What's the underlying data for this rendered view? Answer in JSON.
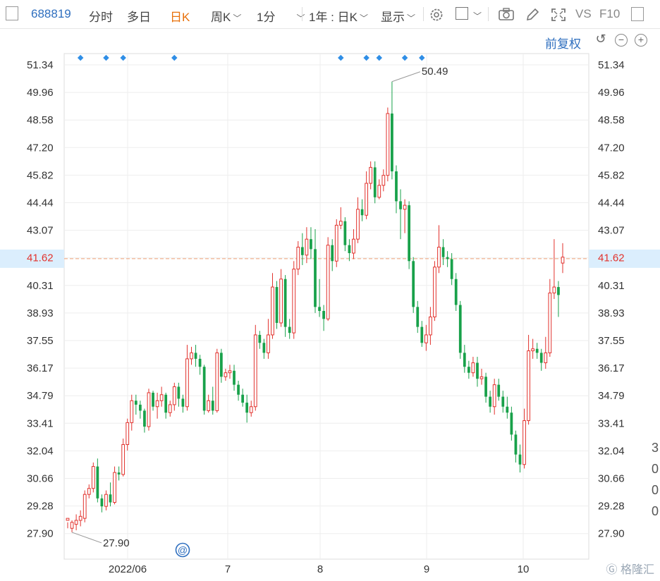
{
  "toolbar": {
    "code": "688819",
    "fenshi": "分时",
    "duori": "多日",
    "rik": "日K",
    "zhouk": "周K",
    "oneminute": "1分",
    "range": "1年 : 日K",
    "display": "显示",
    "vs": "VS",
    "f10": "F10"
  },
  "subbar": {
    "adjust": "前复权"
  },
  "colors": {
    "up": "#e2322d",
    "down": "#18a14a",
    "accent": "#2f6fbf",
    "current_line": "#f0a37a"
  },
  "chart_data": {
    "type": "candlestick",
    "y_ticks": [
      "51.34",
      "49.96",
      "48.58",
      "47.20",
      "45.82",
      "44.44",
      "43.07",
      "41.62",
      "40.31",
      "38.93",
      "37.55",
      "36.17",
      "34.79",
      "33.41",
      "32.04",
      "30.66",
      "29.28",
      "27.90"
    ],
    "x_ticks": [
      "2022/06",
      "7",
      "8",
      "9",
      "10"
    ],
    "current_price": "41.62",
    "high_annotation": "50.49",
    "low_annotation": "27.90",
    "ylim": [
      27.2,
      52.0
    ],
    "candles": [
      [
        28.5,
        28.6,
        28.4,
        28.1
      ],
      [
        28.1,
        28.4,
        28.5,
        27.9
      ],
      [
        28.3,
        28.5,
        28.8,
        28.0
      ],
      [
        28.5,
        28.7,
        29.0,
        28.2
      ],
      [
        28.6,
        29.8,
        30.0,
        28.4
      ],
      [
        29.8,
        30.1,
        30.3,
        29.6
      ],
      [
        30.1,
        31.2,
        31.4,
        29.9
      ],
      [
        31.2,
        29.6,
        31.6,
        29.4
      ],
      [
        29.6,
        29.2,
        29.8,
        28.9
      ],
      [
        29.2,
        29.8,
        30.0,
        29.0
      ],
      [
        29.8,
        29.4,
        30.4,
        29.2
      ],
      [
        29.4,
        30.9,
        31.2,
        29.3
      ],
      [
        30.9,
        30.8,
        31.2,
        30.5
      ],
      [
        30.8,
        32.3,
        32.6,
        30.7
      ],
      [
        32.3,
        33.4,
        33.6,
        32.0
      ],
      [
        33.4,
        34.5,
        34.8,
        33.0
      ],
      [
        34.5,
        34.3,
        34.8,
        33.8
      ],
      [
        34.3,
        34.0,
        34.5,
        33.6
      ],
      [
        34.0,
        33.2,
        34.1,
        32.9
      ],
      [
        33.2,
        34.9,
        35.1,
        33.0
      ],
      [
        34.9,
        34.2,
        35.0,
        34.0
      ],
      [
        34.2,
        34.5,
        34.9,
        33.6
      ],
      [
        34.5,
        34.8,
        35.2,
        34.2
      ],
      [
        34.8,
        33.9,
        34.9,
        33.6
      ],
      [
        33.9,
        34.3,
        34.5,
        33.7
      ],
      [
        34.3,
        35.2,
        35.4,
        34.0
      ],
      [
        35.2,
        34.6,
        35.4,
        34.2
      ],
      [
        34.6,
        34.2,
        34.8,
        33.9
      ],
      [
        34.2,
        36.6,
        37.3,
        34.0
      ],
      [
        36.6,
        36.9,
        37.2,
        36.3
      ],
      [
        36.9,
        36.6,
        37.3,
        36.2
      ],
      [
        36.6,
        36.2,
        36.8,
        35.8
      ],
      [
        36.2,
        34.0,
        36.3,
        33.8
      ],
      [
        34.0,
        34.5,
        34.8,
        33.9
      ],
      [
        34.5,
        34.0,
        35.2,
        33.8
      ],
      [
        34.0,
        36.9,
        37.1,
        33.9
      ],
      [
        36.9,
        35.7,
        37.1,
        35.4
      ],
      [
        35.7,
        35.9,
        36.1,
        35.5
      ],
      [
        35.9,
        36.0,
        36.3,
        35.6
      ],
      [
        36.0,
        35.3,
        36.3,
        35.0
      ],
      [
        35.3,
        34.8,
        35.5,
        34.5
      ],
      [
        34.8,
        34.4,
        35.1,
        34.2
      ],
      [
        34.4,
        33.9,
        34.8,
        33.4
      ],
      [
        33.9,
        34.2,
        34.5,
        33.7
      ],
      [
        34.2,
        37.8,
        38.3,
        34.0
      ],
      [
        37.8,
        37.4,
        38.0,
        37.1
      ],
      [
        37.4,
        36.9,
        37.6,
        36.6
      ],
      [
        36.9,
        37.8,
        38.6,
        36.6
      ],
      [
        37.8,
        40.2,
        40.9,
        37.6
      ],
      [
        40.2,
        38.4,
        40.5,
        38.1
      ],
      [
        38.4,
        40.6,
        41.1,
        38.2
      ],
      [
        40.6,
        38.2,
        40.8,
        37.7
      ],
      [
        38.2,
        37.9,
        38.6,
        37.6
      ],
      [
        37.9,
        41.1,
        41.5,
        37.6
      ],
      [
        41.1,
        42.2,
        42.5,
        40.8
      ],
      [
        42.2,
        41.8,
        42.9,
        41.3
      ],
      [
        41.8,
        42.6,
        43.2,
        41.4
      ],
      [
        42.6,
        42.1,
        43.2,
        41.6
      ],
      [
        42.1,
        39.2,
        43.1,
        38.9
      ],
      [
        39.2,
        39.0,
        40.6,
        38.7
      ],
      [
        39.0,
        38.6,
        39.3,
        38.0
      ],
      [
        38.6,
        42.3,
        42.7,
        38.5
      ],
      [
        42.3,
        41.5,
        42.6,
        41.0
      ],
      [
        41.5,
        43.3,
        43.6,
        41.2
      ],
      [
        43.3,
        43.5,
        44.2,
        43.1
      ],
      [
        43.5,
        42.3,
        43.7,
        42.0
      ],
      [
        42.3,
        41.9,
        42.6,
        41.5
      ],
      [
        41.9,
        42.6,
        43.1,
        41.6
      ],
      [
        42.6,
        44.1,
        44.7,
        42.4
      ],
      [
        44.1,
        43.8,
        44.6,
        43.5
      ],
      [
        43.8,
        45.4,
        46.0,
        43.6
      ],
      [
        45.4,
        46.2,
        46.5,
        45.1
      ],
      [
        46.2,
        44.7,
        46.5,
        44.4
      ],
      [
        44.7,
        45.3,
        45.6,
        44.6
      ],
      [
        45.3,
        45.8,
        46.1,
        45.0
      ],
      [
        45.8,
        48.9,
        49.2,
        45.5
      ],
      [
        48.9,
        46.0,
        50.5,
        45.6
      ],
      [
        46.0,
        44.5,
        46.3,
        43.9
      ],
      [
        44.5,
        44.1,
        45.1,
        42.6
      ],
      [
        44.1,
        44.3,
        44.6,
        42.9
      ],
      [
        44.3,
        41.5,
        44.5,
        41.1
      ],
      [
        41.5,
        39.2,
        41.7,
        38.9
      ],
      [
        39.2,
        38.2,
        39.5,
        37.9
      ],
      [
        38.2,
        37.4,
        38.5,
        37.2
      ],
      [
        37.4,
        37.8,
        38.3,
        37.0
      ],
      [
        37.8,
        38.7,
        39.2,
        37.3
      ],
      [
        38.7,
        41.2,
        41.5,
        38.5
      ],
      [
        41.2,
        42.2,
        43.3,
        40.9
      ],
      [
        42.2,
        41.7,
        42.6,
        41.3
      ],
      [
        41.7,
        41.6,
        42.0,
        41.2
      ],
      [
        41.6,
        40.6,
        41.9,
        40.3
      ],
      [
        40.6,
        39.3,
        40.9,
        39.0
      ],
      [
        39.3,
        36.9,
        39.5,
        36.6
      ],
      [
        36.9,
        36.2,
        37.3,
        35.9
      ],
      [
        36.2,
        35.9,
        36.5,
        35.6
      ],
      [
        35.9,
        36.4,
        36.7,
        35.7
      ],
      [
        36.4,
        35.6,
        36.7,
        35.2
      ],
      [
        35.6,
        35.7,
        36.1,
        35.3
      ],
      [
        35.7,
        34.7,
        35.9,
        34.4
      ],
      [
        34.7,
        34.2,
        35.0,
        33.9
      ],
      [
        34.2,
        35.3,
        35.6,
        33.8
      ],
      [
        35.3,
        34.7,
        35.6,
        34.5
      ],
      [
        34.7,
        34.2,
        35.0,
        33.9
      ],
      [
        34.2,
        33.9,
        34.7,
        33.6
      ],
      [
        33.9,
        32.8,
        34.2,
        32.5
      ],
      [
        32.8,
        31.8,
        33.0,
        31.4
      ],
      [
        31.8,
        31.3,
        32.3,
        30.9
      ],
      [
        31.3,
        33.5,
        34.1,
        31.1
      ],
      [
        33.5,
        37.0,
        37.8,
        33.3
      ],
      [
        37.0,
        37.1,
        37.6,
        36.6
      ],
      [
        37.1,
        36.9,
        37.4,
        36.6
      ],
      [
        36.9,
        36.4,
        37.1,
        36.0
      ],
      [
        36.4,
        36.9,
        37.7,
        36.1
      ],
      [
        36.9,
        39.9,
        40.6,
        36.7
      ],
      [
        39.9,
        40.2,
        42.6,
        39.6
      ],
      [
        40.2,
        39.8,
        40.5,
        38.7
      ],
      [
        41.4,
        41.7,
        42.4,
        40.9
      ]
    ]
  },
  "event_markers": [
    3,
    9,
    13,
    25,
    64,
    70,
    73,
    79,
    83
  ],
  "right_edge": [
    "3",
    "0",
    "0",
    "0"
  ],
  "watermark": "格隆汇"
}
